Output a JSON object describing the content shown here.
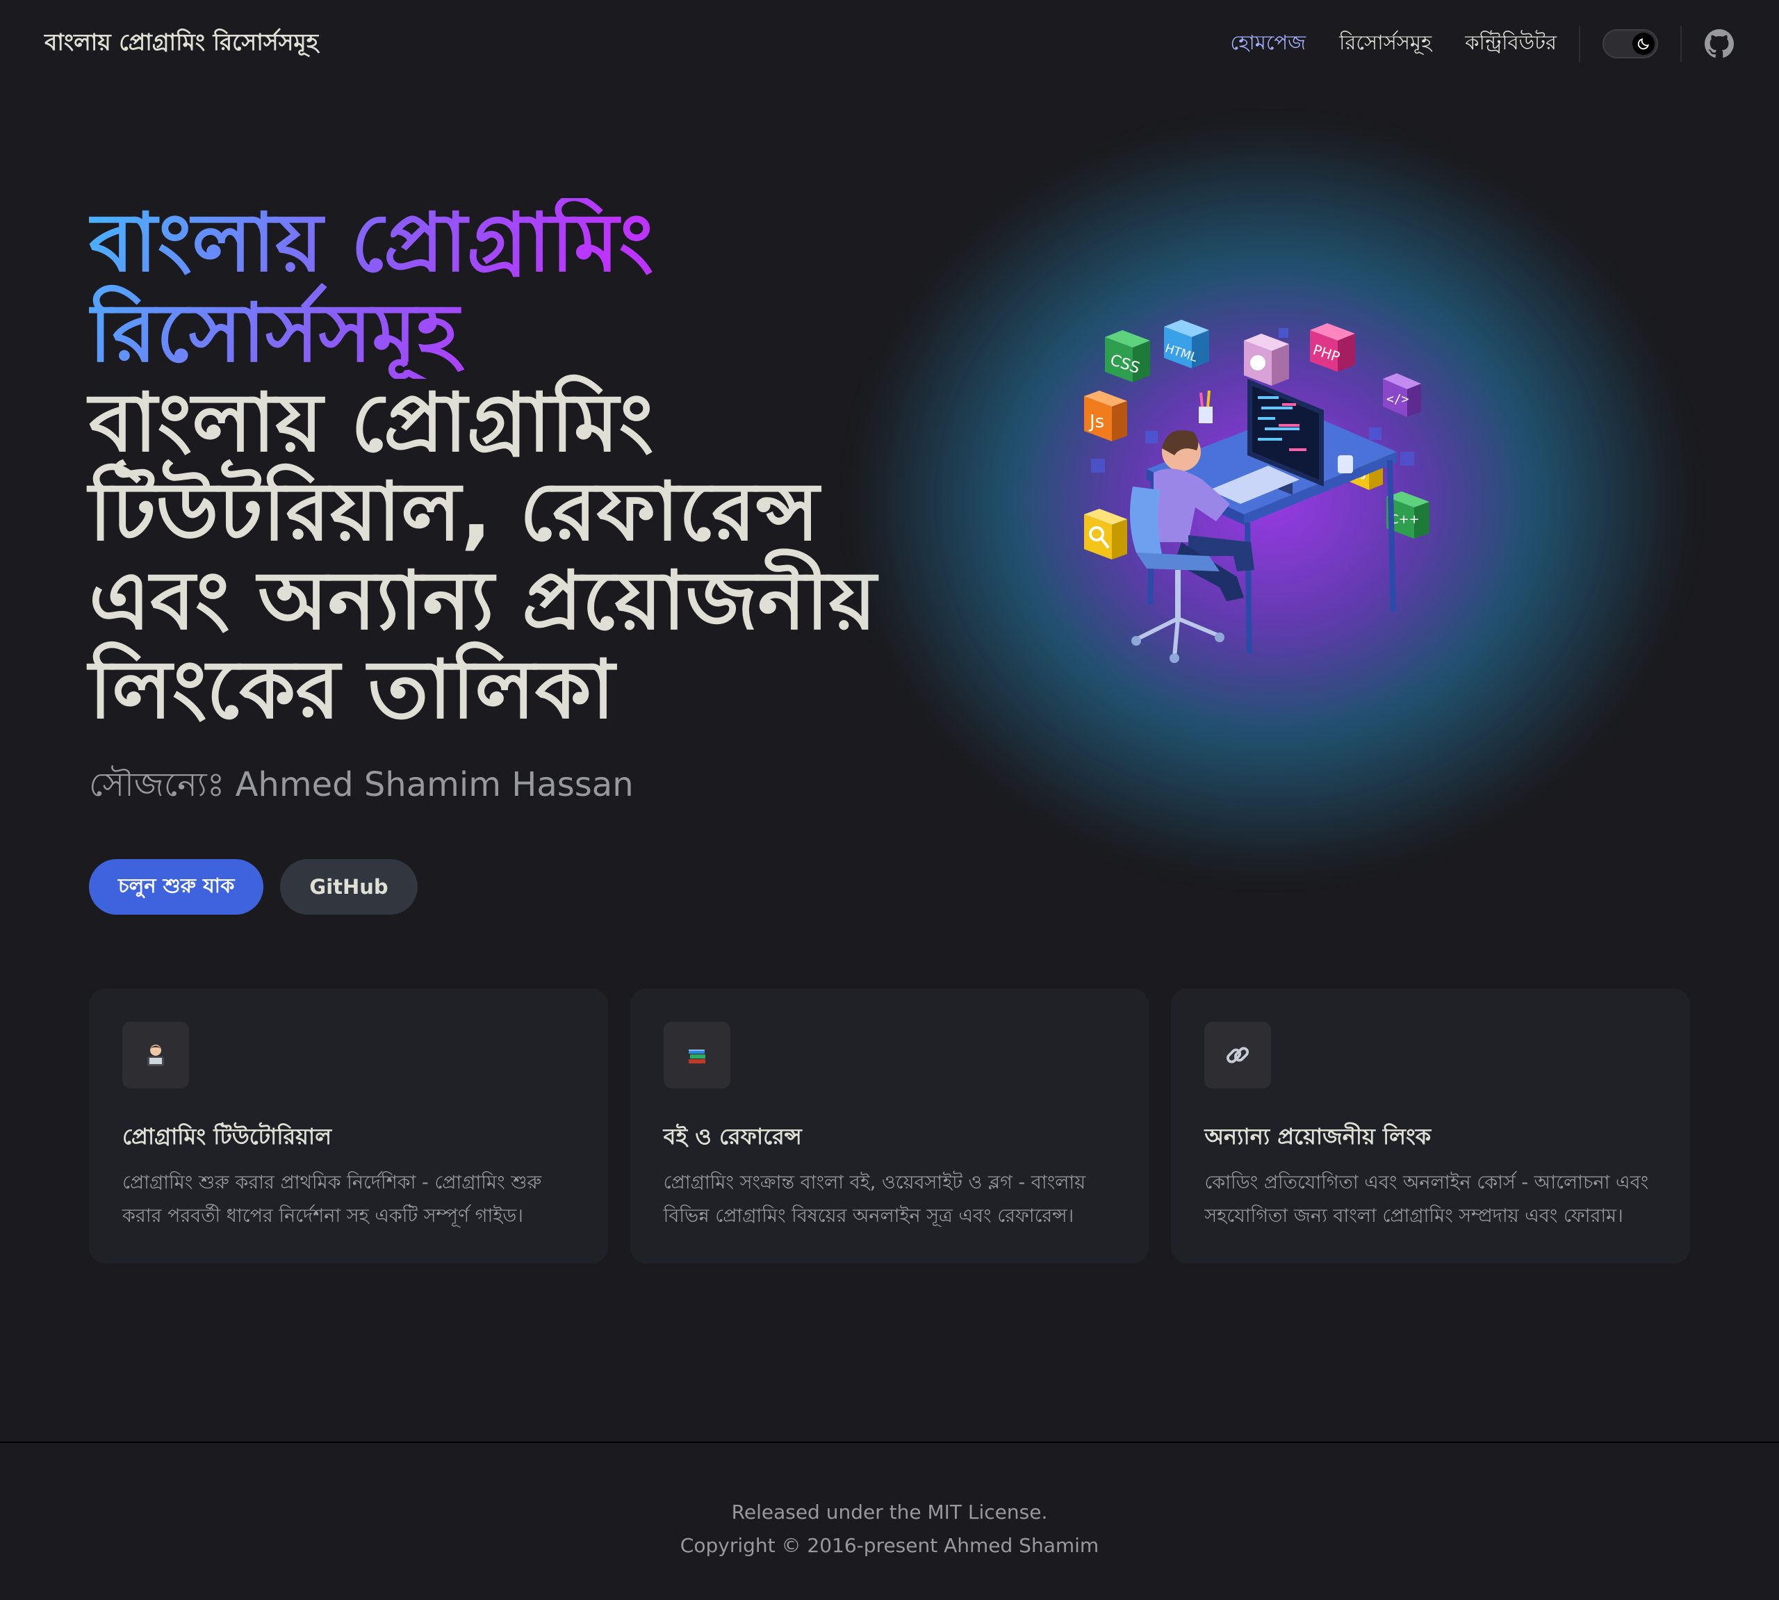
{
  "nav": {
    "site_title": "বাংলায় প্রোগ্রামিং রিসোর্সসমূহ",
    "links": [
      {
        "label": "হোমপেজ",
        "active": true
      },
      {
        "label": "রিসোর্সসমূহ",
        "active": false
      },
      {
        "label": "কন্ট্রিবিউটর",
        "active": false
      }
    ],
    "appearance_toggle": "dark",
    "social_icon": "github-icon"
  },
  "hero": {
    "name": "বাংলায় প্রোগ্রামিং রিসোর্সসমূহ",
    "tagline": "বাংলায় প্রোগ্রামিং টিউটরিয়াল, রেফারেন্স এবং অন্যান্য প্রয়োজনীয় লিংকের তালিকা",
    "credit": "সৌজন্যেঃ Ahmed Shamim Hassan",
    "actions": [
      {
        "label": "চলুন শুরু যাক",
        "theme": "brand"
      },
      {
        "label": "GitHub",
        "theme": "alt"
      }
    ],
    "image_icon": "programmer-at-desk-illustration"
  },
  "features": [
    {
      "icon": "technologist-emoji",
      "title": "প্রোগ্রামিং টিউটোরিয়াল",
      "details": "প্রোগ্রামিং শুরু করার প্রাথমিক নির্দেশিকা - প্রোগ্রামিং শুরু করার পরবর্তী ধাপের নির্দেশনা সহ একটি সম্পূর্ণ গাইড।"
    },
    {
      "icon": "books-emoji",
      "title": "বই ও রেফারেন্স",
      "details": "প্রোগ্রামিং সংক্রান্ত বাংলা বই, ওয়েবসাইট ও ব্লগ - বাংলায় বিভিন্ন প্রোগ্রামিং বিষয়ের অনলাইন সূত্র এবং রেফারেন্স।"
    },
    {
      "icon": "link-emoji",
      "title": "অন্যান্য প্রয়োজনীয় লিংক",
      "details": "কোডিং প্রতিযোগিতা এবং অনলাইন কোর্স - আলোচনা এবং সহযোগিতা জন্য বাংলা প্রোগ্রামিং সম্প্রদায় এবং ফোরাম।"
    }
  ],
  "footer": {
    "message": "Released under the MIT License.",
    "copyright": "Copyright © 2016-present Ahmed Shamim"
  },
  "colors": {
    "background": "#1b1b1f",
    "brand": "#3e63dd",
    "nav_active": "#a8b1ff",
    "card": "#202127"
  }
}
